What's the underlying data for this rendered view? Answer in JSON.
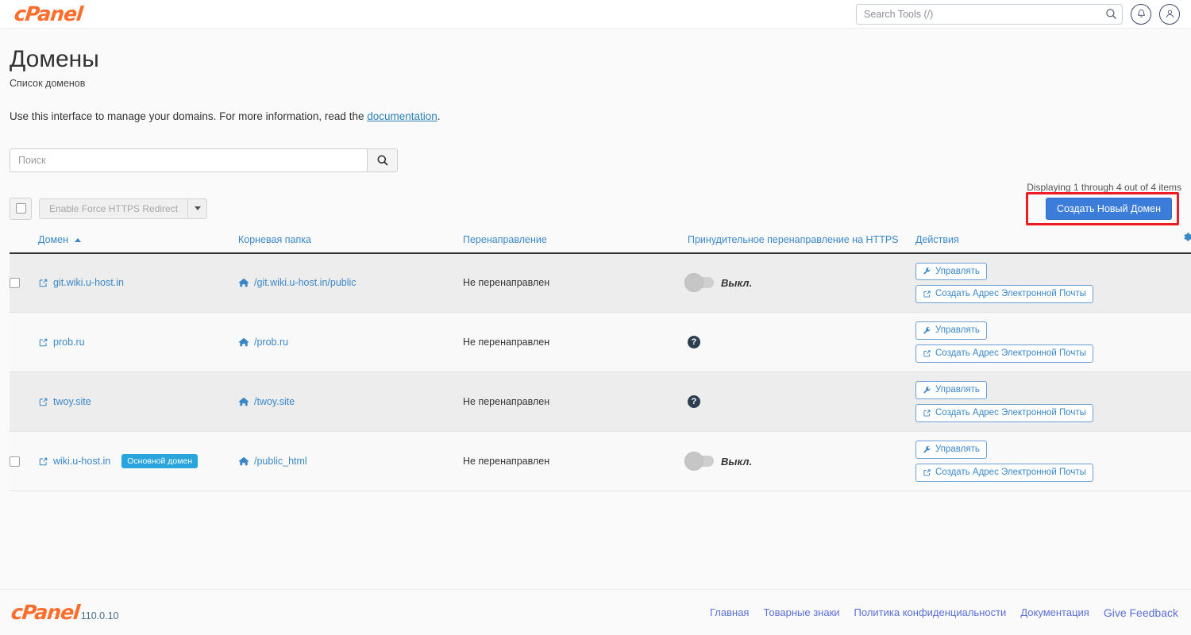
{
  "header": {
    "brand": "cPanel",
    "search_placeholder": "Search Tools (/)",
    "search_value": "",
    "notifications_icon": "bell-icon",
    "account_icon": "user-icon"
  },
  "page": {
    "title": "Домены",
    "subtitle": "Список доменов",
    "intro_prefix": "Use this interface to manage your domains. For more information, read the ",
    "intro_link": "documentation",
    "intro_suffix": "."
  },
  "filter": {
    "placeholder": "Поиск",
    "value": "",
    "search_icon": "search-icon"
  },
  "toolbar": {
    "count_text": "Displaying 1 through 4 out of 4 items",
    "select_all_checked": false,
    "bulk_action_label": "Enable Force HTTPS Redirect",
    "bulk_action_disabled": true,
    "dropdown_icon": "chevron-down-icon",
    "create_label": "Создать Новый Домен",
    "highlight_color": "#ee1d24",
    "primary_color": "#3b7dd8"
  },
  "table": {
    "columns": {
      "domain": "Домен",
      "root": "Корневая папка",
      "redirect": "Перенаправление",
      "https": "Принудительное перенаправление на HTTPS",
      "actions": "Действия"
    },
    "sort_column": "domain",
    "sort_direction": "asc",
    "settings_icon": "gear-icon",
    "rows": [
      {
        "has_checkbox": true,
        "domain": "git.wiki.u-host.in",
        "badge": null,
        "root": "/git.wiki.u-host.in/public",
        "redirect": "Не перенаправлен",
        "https_type": "toggle",
        "https_state": "off",
        "https_label": "Выкл.",
        "manage_label": "Управлять",
        "email_label": "Создать Адрес Электронной Почты"
      },
      {
        "has_checkbox": false,
        "domain": "prob.ru",
        "badge": null,
        "root": "/prob.ru",
        "redirect": "Не перенаправлен",
        "https_type": "help",
        "https_state": null,
        "https_label": "?",
        "manage_label": "Управлять",
        "email_label": "Создать Адрес Электронной Почты"
      },
      {
        "has_checkbox": false,
        "domain": "twoy.site",
        "badge": null,
        "root": "/twoy.site",
        "redirect": "Не перенаправлен",
        "https_type": "help",
        "https_state": null,
        "https_label": "?",
        "manage_label": "Управлять",
        "email_label": "Создать Адрес Электронной Почты"
      },
      {
        "has_checkbox": true,
        "domain": "wiki.u-host.in",
        "badge": "Основной домен",
        "root": "/public_html",
        "redirect": "Не перенаправлен",
        "https_type": "toggle",
        "https_state": "off",
        "https_label": "Выкл.",
        "manage_label": "Управлять",
        "email_label": "Создать Адрес Электронной Почты"
      }
    ]
  },
  "footer": {
    "brand": "cPanel",
    "version": "110.0.10",
    "links": [
      "Главная",
      "Товарные знаки",
      "Политика конфиденциальности",
      "Документация",
      "Give Feedback"
    ]
  }
}
